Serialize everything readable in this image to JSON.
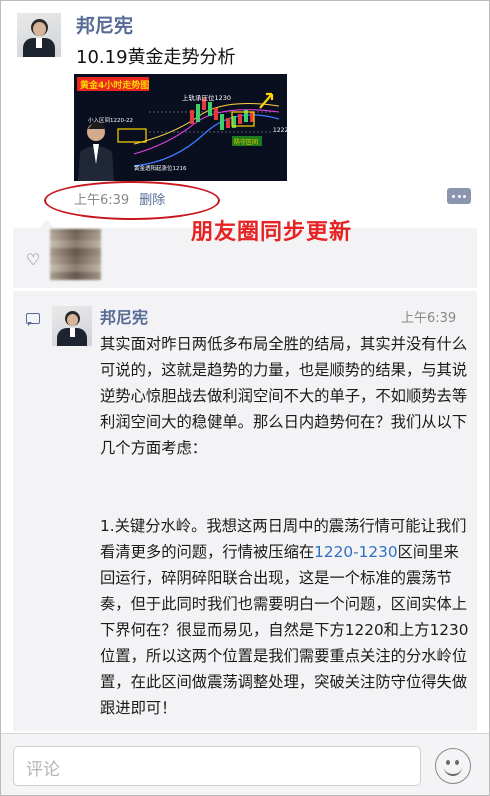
{
  "post": {
    "author": "邦尼宪",
    "text": "10.19黄金走势分析",
    "time": "上午6:39",
    "delete_label": "删除",
    "image": {
      "title": "黄金4小时走势图",
      "labels": {
        "upper": "上轨承压位1230",
        "left": "小入区间1220-22",
        "lower": "黄金透阳起涨位1216",
        "right_price": "1222",
        "guard": "防守区间"
      }
    }
  },
  "annotation": {
    "sync_note": "朋友圈同步更新"
  },
  "icons": {
    "avatar": "avatar-man-in-suit",
    "comment": "comment-dots-icon",
    "like": "heart-icon",
    "comment_bubble": "speech-bubble-icon",
    "emoji": "smiley-icon"
  },
  "colors": {
    "link": "#576b95",
    "highlight": "#e62222"
  },
  "comment": {
    "author": "邦尼宪",
    "time": "上午6:39",
    "para1": "其实面对昨日两低多布局全胜的结局，其实并没有什么可说的，这就是趋势的力量，也是顺势的结果，与其说逆势心惊胆战去做利润空间不大的单子，不如顺势去等利润空间大的稳健单。那么日内趋势何在？我们从以下几个方面考虑：",
    "para2_a": "1.关键分水岭。我想这两日周中的震荡行情可能让我们看清更多的问题，行情被压缩在",
    "para2_link": "1220-1230",
    "para2_b": "区间里来回运行，碎阴碎阳联合出现，这是一个标准的震荡节奏，但于此同时我们也需要明白一个问题，区间实体上下界何在？很显而易见，自然是下方1220和上方1230位置，所以这两个位置是我们需要重点关注的分水岭位置，在此区间做震荡调整处理，突破关注防守位得失做跟进即可！"
  },
  "input": {
    "placeholder": "评论"
  }
}
